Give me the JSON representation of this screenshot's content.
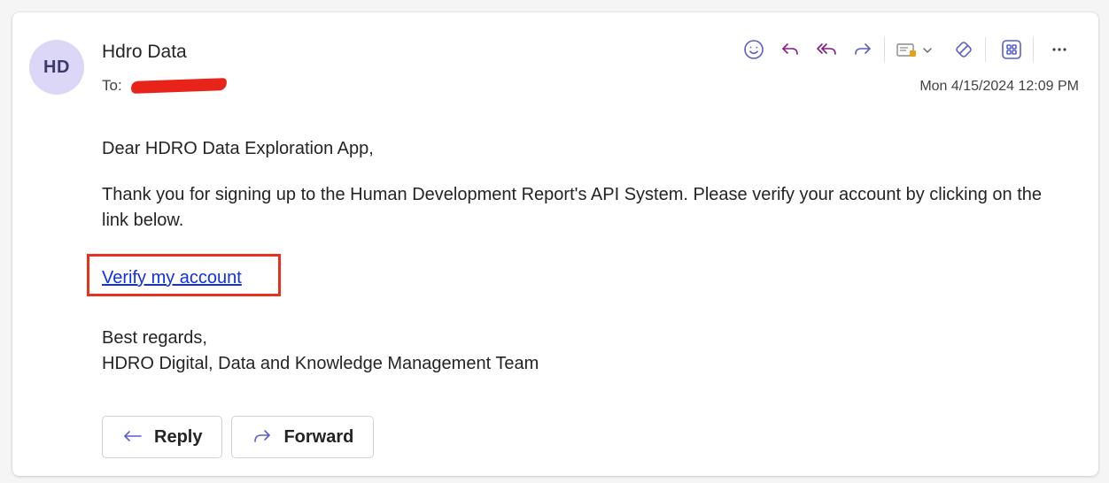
{
  "header": {
    "avatar_initials": "HD",
    "sender_name": "Hdro Data",
    "to_label": "To:",
    "date": "Mon 4/15/2024 12:09 PM"
  },
  "toolbar": {
    "icons": [
      "emoji-icon",
      "reply-icon",
      "reply-all-icon",
      "forward-icon",
      "move-to-icon",
      "sensitivity-icon",
      "apps-icon",
      "more-icon"
    ],
    "more_label": "···"
  },
  "body": {
    "greeting": "Dear HDRO Data Exploration App,",
    "paragraph": "Thank you for signing up to the Human Development Report's API System. Please verify your account by clicking on the link below.",
    "link_text": "Verify my account",
    "signoff": "Best regards,",
    "team": "HDRO Digital, Data and Knowledge Management Team"
  },
  "actions": {
    "reply_label": "Reply",
    "forward_label": "Forward"
  },
  "colors": {
    "accent": "#5b5fc7",
    "link": "#0f2ff0",
    "annotation": "#e8321e",
    "avatar_bg": "#dcd6f7"
  }
}
